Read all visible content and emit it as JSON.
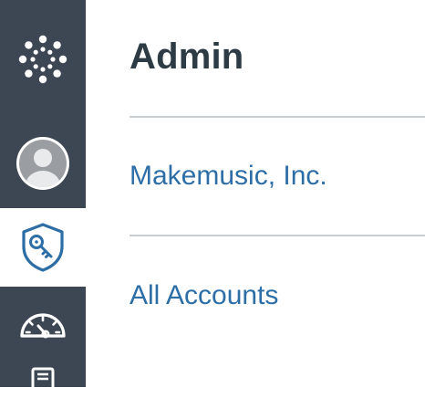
{
  "nav": {
    "items": [
      {
        "icon": "canvas-logo-icon"
      },
      {
        "icon": "user-avatar-icon"
      },
      {
        "icon": "admin-shield-key-icon",
        "active": true
      },
      {
        "icon": "dashboard-gauge-icon"
      },
      {
        "icon": "courses-book-icon"
      }
    ],
    "colors": {
      "background": "#3d4754",
      "active_background": "#ffffff",
      "active_icon": "#2d6ea6"
    }
  },
  "main": {
    "title": "Admin",
    "accounts": [
      {
        "label": "Makemusic, Inc."
      },
      {
        "label": "All Accounts"
      }
    ],
    "colors": {
      "title": "#2d3b45",
      "link": "#2d6ea6",
      "divider": "#c7cdd1"
    }
  }
}
